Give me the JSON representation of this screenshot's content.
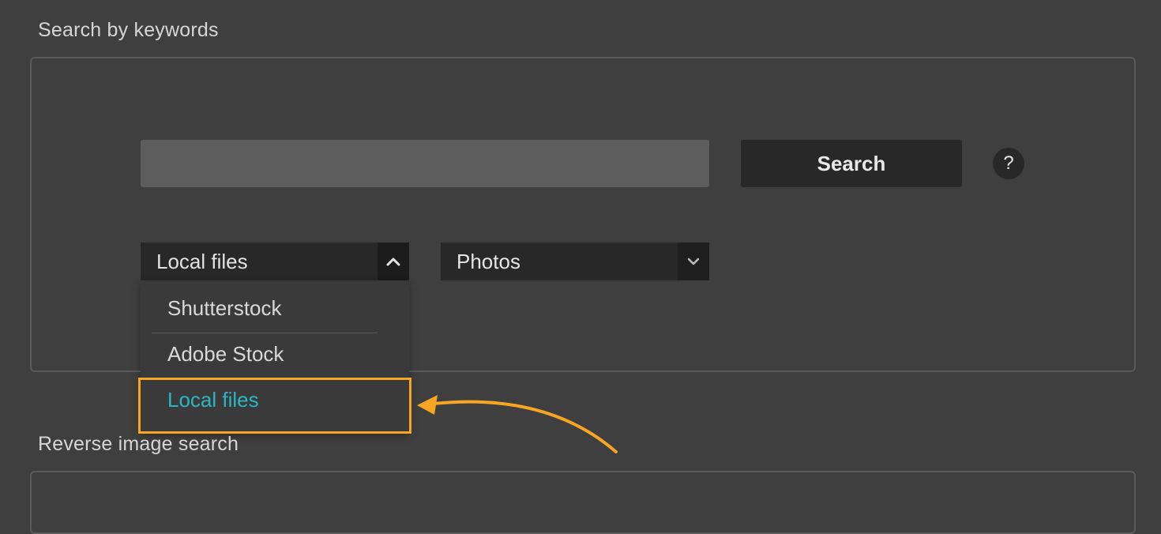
{
  "keywords_section": {
    "title": "Search by keywords",
    "search_input": {
      "value": "",
      "placeholder": ""
    },
    "search_button_label": "Search",
    "help_label": "?",
    "source_select": {
      "selected": "Local files",
      "expanded": true,
      "options": [
        "Shutterstock",
        "Adobe Stock",
        "Local files"
      ],
      "highlighted_option": "Local files"
    },
    "type_select": {
      "selected": "Photos"
    }
  },
  "reverse_section": {
    "title": "Reverse image search"
  },
  "colors": {
    "background": "#3f3f3f",
    "selected_option": "#2bb6c2",
    "annotation": "#f6a623"
  }
}
